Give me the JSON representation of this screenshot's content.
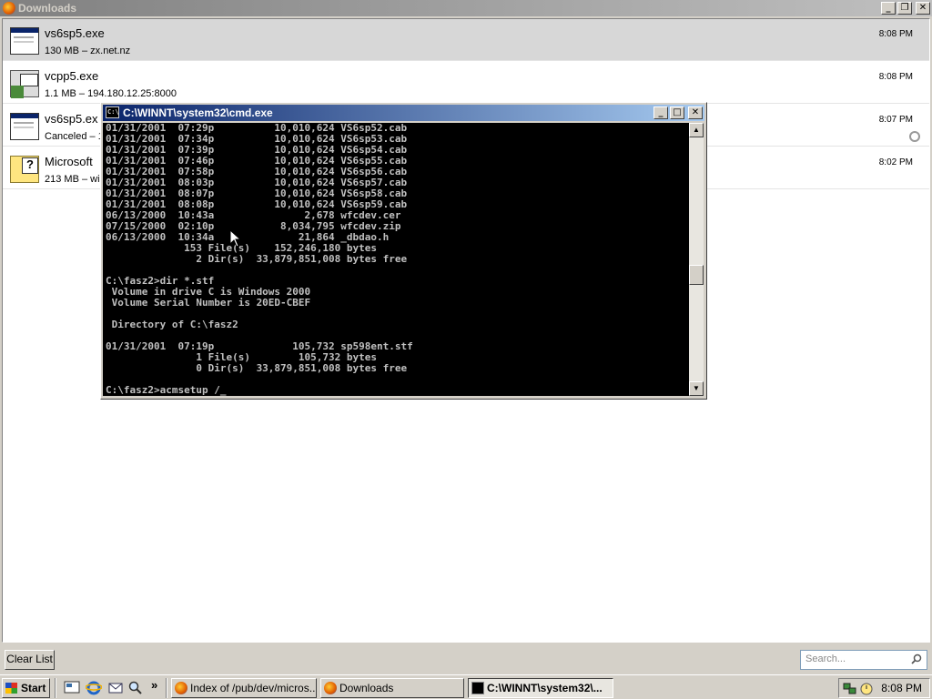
{
  "downloads_window": {
    "title": "Downloads",
    "items": [
      {
        "name": "vs6sp5.exe",
        "details": "130 MB – zx.net.nz",
        "time": "8:08 PM",
        "icon": "exe-icon"
      },
      {
        "name": "vcpp5.exe",
        "details": "1.1 MB – 194.180.12.25:8000",
        "time": "8:08 PM",
        "icon": "setup-icon"
      },
      {
        "name": "vs6sp5.ex",
        "details": "Canceled – 1",
        "time": "8:07 PM",
        "icon": "exe-icon"
      },
      {
        "name": "Microsoft ",
        "details": "213 MB – wir",
        "time": "8:02 PM",
        "icon": "help-icon"
      }
    ],
    "clear_list_label": "Clear List",
    "search_placeholder": "Search..."
  },
  "cmd_window": {
    "title": "C:\\WINNT\\system32\\cmd.exe",
    "icon_label": "C:\\",
    "output": "01/31/2001  07:29p          10,010,624 VS6sp52.cab\n01/31/2001  07:34p          10,010,624 VS6sp53.cab\n01/31/2001  07:39p          10,010,624 VS6sp54.cab\n01/31/2001  07:46p          10,010,624 VS6sp55.cab\n01/31/2001  07:58p          10,010,624 VS6sp56.cab\n01/31/2001  08:03p          10,010,624 VS6sp57.cab\n01/31/2001  08:07p          10,010,624 VS6sp58.cab\n01/31/2001  08:08p          10,010,624 VS6sp59.cab\n06/13/2000  10:43a               2,678 wfcdev.cer\n07/15/2000  02:10p           8,034,795 wfcdev.zip\n06/13/2000  10:34a              21,864 _dbdao.h\n             153 File(s)    152,246,180 bytes\n               2 Dir(s)  33,879,851,008 bytes free\n\nC:\\fasz2>dir *.stf\n Volume in drive C is Windows 2000\n Volume Serial Number is 20ED-CBEF\n\n Directory of C:\\fasz2\n\n01/31/2001  07:19p             105,732 sp598ent.stf\n               1 File(s)        105,732 bytes\n               0 Dir(s)  33,879,851,008 bytes free\n\nC:\\fasz2>acmsetup /_"
  },
  "taskbar": {
    "start_label": "Start",
    "tasks": [
      {
        "label": "Index of /pub/dev/micros...",
        "icon": "firefox-icon",
        "active": false
      },
      {
        "label": "Downloads",
        "icon": "firefox-icon",
        "active": false
      },
      {
        "label": "C:\\WINNT\\system32\\...",
        "icon": "cmd-icon",
        "active": true
      }
    ],
    "clock": "8:08 PM",
    "quick_launch_chevron": "»"
  }
}
